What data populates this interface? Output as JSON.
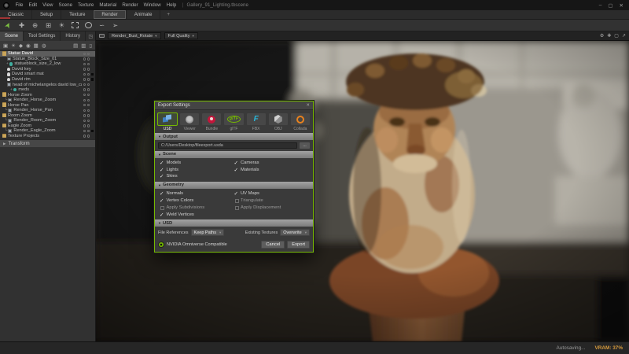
{
  "menu_bar": {
    "items": [
      "File",
      "Edit",
      "View",
      "Scene",
      "Texture",
      "Material",
      "Render",
      "Window",
      "Help"
    ],
    "separator": "|",
    "document_title": "Gallery_91_Lighting.tbscene",
    "window_controls": {
      "minimize": "–",
      "maximize": "▢",
      "close": "✕"
    }
  },
  "workspace_tabs": {
    "tabs": [
      {
        "label": "Classic"
      },
      {
        "label": "Setup"
      },
      {
        "label": "Texture"
      },
      {
        "label": "Render",
        "active": true
      },
      {
        "label": "Animate"
      }
    ],
    "add_button": "+"
  },
  "toolbar": {
    "tools": [
      {
        "name": "select-tool",
        "glyph": "➤"
      },
      {
        "name": "translate-tool",
        "glyph": "✚"
      },
      {
        "name": "rotate-tool",
        "glyph": "⊕"
      },
      {
        "name": "scale-tool",
        "glyph": "⊞"
      },
      {
        "name": "light-tool",
        "glyph": "☀"
      },
      {
        "name": "marquee-select-tool",
        "glyph": ""
      },
      {
        "name": "ellipse-select-tool",
        "glyph": ""
      },
      {
        "name": "lasso-select-tool",
        "glyph": "∽"
      },
      {
        "name": "paint-select-tool",
        "glyph": "➢"
      }
    ]
  },
  "left_panel": {
    "tabs": [
      {
        "label": "Scene",
        "active": true
      },
      {
        "label": "Tool Settings"
      },
      {
        "label": "History"
      }
    ],
    "popout_glyph": "◳",
    "header_icon_glyphs": [
      "▣",
      "☀",
      "◆",
      "◉",
      "▦",
      "◍"
    ],
    "header_icon_glyphs_right": [
      "▤",
      "▥",
      "▯"
    ],
    "tree": [
      {
        "label": "Statue David",
        "pad": "2px",
        "prefix": "",
        "icon": "folder",
        "selected": true
      },
      {
        "label": "Statue_Block_Size_01",
        "pad": "8px",
        "prefix": "",
        "icon": "camera"
      },
      {
        "label": "statueblock_size_2_low",
        "pad": "8px",
        "prefix": "+",
        "icon": "mesh"
      },
      {
        "label": "David key",
        "pad": "8px",
        "prefix": "",
        "icon": "light"
      },
      {
        "label": "David smart mat",
        "pad": "8px",
        "prefix": "",
        "icon": "light",
        "dot": true
      },
      {
        "label": "David rim",
        "pad": "8px",
        "prefix": "",
        "icon": "light",
        "dot": true
      },
      {
        "label": "head of michelangelos david low_ca",
        "pad": "8px",
        "prefix": "",
        "icon": "camera"
      },
      {
        "label": "meds",
        "pad": "13px",
        "prefix": "+",
        "icon": "mesh"
      },
      {
        "label": "Horse Zoom",
        "pad": "2px",
        "prefix": "",
        "icon": "folder"
      },
      {
        "label": "Render_Horse_Zoom",
        "pad": "6px",
        "prefix": "└",
        "icon": "camera"
      },
      {
        "label": "Horse Pan",
        "pad": "2px",
        "prefix": "",
        "icon": "folder"
      },
      {
        "label": "Render_Horse_Pan",
        "pad": "6px",
        "prefix": "└",
        "icon": "camera"
      },
      {
        "label": "Room Zoom",
        "pad": "2px",
        "prefix": "",
        "icon": "folder"
      },
      {
        "label": "Render_Room_Zoom",
        "pad": "6px",
        "prefix": "└",
        "icon": "camera"
      },
      {
        "label": "Eagle Zoom",
        "pad": "2px",
        "prefix": "",
        "icon": "folder"
      },
      {
        "label": "Render_Eagle_Zoom",
        "pad": "6px",
        "prefix": "└",
        "icon": "camera",
        "dot": true
      },
      {
        "label": "Texture Projects",
        "pad": "2px",
        "prefix": "",
        "icon": "folder"
      }
    ],
    "transform_section": {
      "label": "Transform",
      "arrow": "▶"
    }
  },
  "viewport": {
    "camera_select": "Render_Bust_Rotate",
    "quality_select": "Full Quality",
    "caret": "▾",
    "corner_icon_glyphs": [
      "⚙",
      "✚",
      "▢",
      "↗"
    ]
  },
  "export_dialog": {
    "title": "Export Settings",
    "close": "✕",
    "accent_color": "#76b900",
    "formats": [
      {
        "label": "USD",
        "selected": true
      },
      {
        "label": "Viewer"
      },
      {
        "label": "Bundle"
      },
      {
        "label": "glTF"
      },
      {
        "label": "FBX",
        "icon_letter": "F"
      },
      {
        "label": "OBJ"
      },
      {
        "label": "Collada"
      }
    ],
    "output": {
      "header": "Output",
      "path": "C:/Users/Desktop/fileexport.usda",
      "browse_label": "..."
    },
    "scene": {
      "header": "Scene",
      "options": [
        {
          "label": "Models",
          "checked": true
        },
        {
          "label": "Lights",
          "checked": true
        },
        {
          "label": "Skies",
          "checked": true
        },
        {
          "label": "Cameras",
          "checked": true
        },
        {
          "label": "Materials",
          "checked": true
        }
      ]
    },
    "geometry": {
      "header": "Geometry",
      "options": [
        {
          "label": "Normals",
          "checked": true
        },
        {
          "label": "Vertex Colors",
          "checked": true
        },
        {
          "label": "Apply Subdivisions",
          "checked": false
        },
        {
          "label": "Weld Vertices",
          "checked": true
        },
        {
          "label": "UV Maps",
          "checked": true
        },
        {
          "label": "Triangulate",
          "checked": false
        },
        {
          "label": "Apply Displacement",
          "checked": false
        }
      ]
    },
    "usd": {
      "header": "USD",
      "file_references_label": "File References",
      "file_references_value": "Keep Paths",
      "existing_textures_label": "Existing Textures",
      "existing_textures_value": "Overwrite"
    },
    "footer": {
      "badge_label": "NVIDIA Omniverse Compatible",
      "cancel_label": "Cancel",
      "export_label": "Export"
    }
  },
  "status_bar": {
    "autosave": "Autosaving...",
    "vram": "VRAM: 37%",
    "vram_color": "#d79b3c"
  }
}
